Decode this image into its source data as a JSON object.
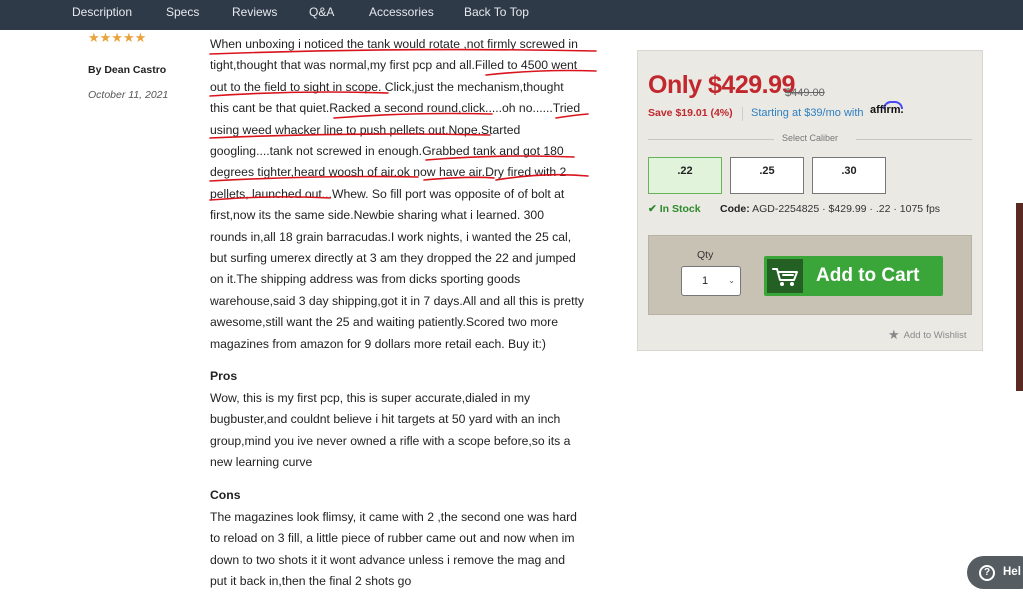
{
  "nav": {
    "items": [
      "Description",
      "Specs",
      "Reviews",
      "Q&A",
      "Accessories",
      "Back To Top"
    ]
  },
  "review": {
    "stars": "★★★★★",
    "rating": 5,
    "author": "By Dean Castro",
    "date": "October 11, 2021",
    "lines": [
      "When unboxing i noticed the tank would rotate ,not firmly screwed in",
      "tight,thought that was normal,my first pcp and all.Filled to 4500 went",
      "out to the field to sight in scope. Click,just the mechanism,thought",
      "this cant be that quiet.Racked a second round,click.....oh no......Tried",
      "using weed whacker line to push pellets out.Nope.Started",
      "googling....tank not screwed in enough.Grabbed tank and got 180",
      "degrees tighter,heard woosh of air,ok now have air.Dry fired with 2",
      "pellets, launched out...Whew. So fill port was opposite of of bolt at",
      "first,now its the same side.Newbie sharing what i learned. 300",
      "rounds in,all 18 grain barracudas.I work nights, i wanted the 25 cal,",
      "but surfing umerex directly at 3 am they dropped the 22 and jumped",
      "on it.The shipping address was from dicks sporting goods",
      "warehouse,said 3 day shipping,got it in 7 days.All and all this is pretty",
      "awesome,still want the 25 and waiting patiently.Scored two more",
      "magazines from amazon for 9 dollars more retail each. Buy it:)"
    ],
    "pros_heading": "Pros",
    "pros_lines": [
      "Wow, this is my first pcp, this is super accurate,dialed in my",
      "bugbuster,and couldnt believe i hit targets at 50 yard with an inch",
      "group,mind you ive never owned a rifle with a scope before,so its a",
      "new learning curve"
    ],
    "cons_heading": "Cons",
    "cons_lines": [
      "The magazines look flimsy, it came with 2 ,the second one was hard",
      "to reload on 3 fill, a little piece of rubber came out and now when im",
      "down to two shots it it wont advance unless i remove the mag and",
      "put it back in,then the final 2 shots go"
    ]
  },
  "product": {
    "price": "Only $429.99",
    "old_price": "$449.00",
    "save": "Save $19.01 (4%)",
    "financing": "Starting at $39/mo with",
    "affirm": "affirm.",
    "caliber_label": "Select Caliber",
    "calibers": [
      ".22",
      ".25",
      ".30"
    ],
    "selected_caliber": ".22",
    "stock": "In Stock",
    "code_label": "Code:",
    "code_value": "AGD-2254825 · $429.99 · .22 · 1075 fps",
    "qty_label": "Qty",
    "qty_value": "1",
    "add_to_cart": "Add to Cart",
    "wishlist": "Add to Wishlist"
  },
  "help": {
    "label": "Hel"
  },
  "colors": {
    "nav_bg": "#2e3a48",
    "price_red": "#c1272d",
    "cart_green": "#3aa63a",
    "stock_green": "#2d8a2d",
    "annotation_red": "#d9141c",
    "link_blue": "#2f7fc1"
  }
}
